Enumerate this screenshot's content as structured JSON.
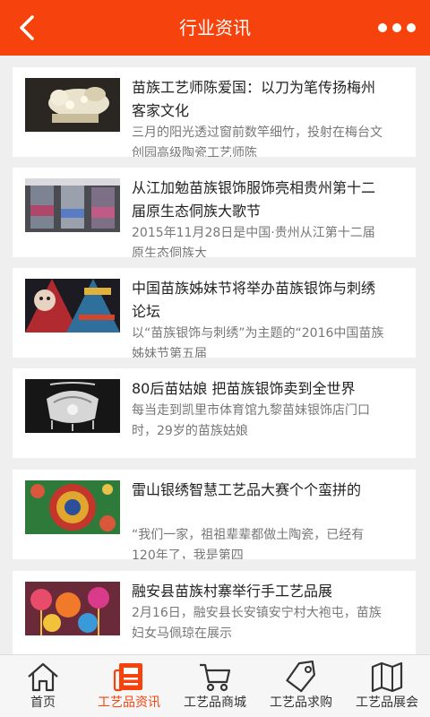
{
  "header": {
    "title": "行业资讯",
    "back_icon": "chevron-left-icon",
    "more_icon": "more-dots-icon",
    "bg_color": "#f6430e"
  },
  "articles": [
    {
      "title": "苗族工艺师陈爱国：以刀为笔传扬梅州客家文化",
      "summary": "三月的阳光透过窗前数竿细竹，投射在梅台文创园高级陶瓷工艺师陈"
    },
    {
      "title": "从江加勉苗族银饰服饰亮相贵州第十二届原生态侗族大歌节",
      "summary": "2015年11月28日是中国·贵州从江第十二届原生态侗族大"
    },
    {
      "title": "中国苗族姊妹节将举办苗族银饰与刺绣论坛",
      "summary": "以“苗族银饰与刺绣”为主题的“2016中国苗族姊妹节第五届"
    },
    {
      "title": "80后苗姑娘 把苗族银饰卖到全世界",
      "summary": "每当走到凯里市体育馆九黎苗妹银饰店门口时，29岁的苗族姑娘"
    },
    {
      "title": "雷山银绣智慧工艺品大赛个个蛮拼的",
      "summary": "“我们一家，祖祖辈辈都做土陶瓷，已经有120年了，我是第四"
    },
    {
      "title": "融安县苗族村寨举行手工艺品展",
      "summary": "2月16日，融安县长安镇安宁村大袍屯，苗族妇女马佩琼在展示"
    }
  ],
  "tabbar": {
    "active_color": "#f6430e",
    "tabs": [
      {
        "label": "首页",
        "icon": "home-icon",
        "active": false
      },
      {
        "label": "工艺品资讯",
        "icon": "news-icon",
        "active": true
      },
      {
        "label": "工艺品商城",
        "icon": "cart-icon",
        "active": false
      },
      {
        "label": "工艺品求购",
        "icon": "tag-icon",
        "active": false
      },
      {
        "label": "工艺品展会",
        "icon": "map-icon",
        "active": false
      }
    ]
  }
}
